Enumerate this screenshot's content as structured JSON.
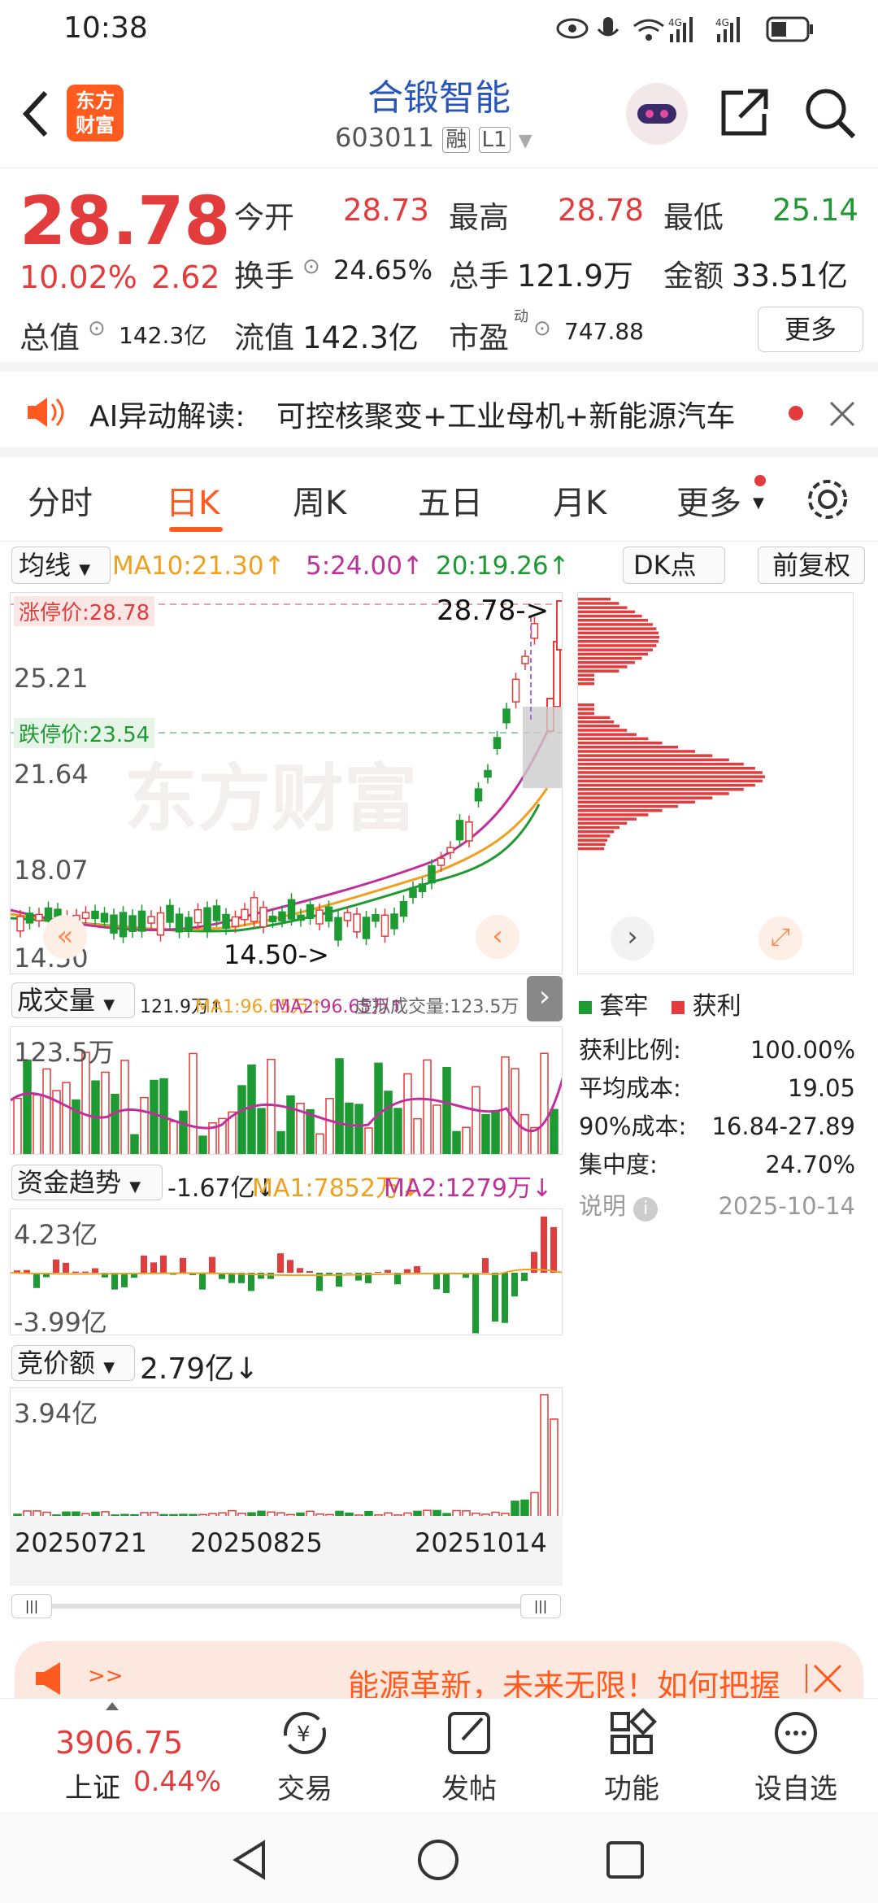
{
  "status": {
    "time": "10:38",
    "net1": "4G",
    "net2": "4G"
  },
  "header": {
    "title": "合锻智能",
    "code": "603011",
    "tag1": "融",
    "tag2": "L1",
    "logo": "东方\n财富"
  },
  "quote": {
    "price": "28.78",
    "pct": "10.02%",
    "chg": "2.62",
    "open_label": "今开",
    "open": "28.73",
    "high_label": "最高",
    "high": "28.78",
    "low_label": "最低",
    "low": "25.14",
    "turn_label": "换手",
    "turn": "24.65%",
    "vol_label": "总手",
    "vol": "121.9万",
    "amt_label": "金额",
    "amt": "33.51亿",
    "cap_label": "总值",
    "cap": "142.3亿",
    "float_label": "流值",
    "float": "142.3亿",
    "pe_label": "市盈",
    "pe_sup": "动",
    "pe": "747.88",
    "more": "更多"
  },
  "ai": {
    "label": "AI异动解读:",
    "text": "可控核聚变+工业母机+新能源汽车"
  },
  "tabs": [
    "分时",
    "日K",
    "周K",
    "五日",
    "月K",
    "更多"
  ],
  "ma_bar": {
    "sel": "均线",
    "ma10": "MA10:21.30↑",
    "ma5": "5:24.00↑",
    "ma20": "20:19.26↑",
    "dk": "DK点",
    "adj": "前复权"
  },
  "kline": {
    "limit_up": "涨停价:28.78",
    "limit_down": "跌停价:23.54",
    "y1": "25.21",
    "y2": "21.64",
    "y3": "18.07",
    "y4": "14.50",
    "high_mark": "28.78->",
    "low_mark": "14.50->",
    "watermark": "东方财富"
  },
  "volume": {
    "sel": "成交量",
    "info": "121.9万↑",
    "ma1": "MA1:96.65万↑",
    "ma2": "MA2:96.65万↑",
    "virt": "虚拟成交量:123.5万",
    "ymax": "123.5万"
  },
  "fund": {
    "sel": "资金趋势",
    "val": "-1.67亿↓",
    "ma1": "MA1:7852万↓",
    "ma2": "MA2:1279万↓",
    "ymax": "4.23亿",
    "ymin": "-3.99亿"
  },
  "bid": {
    "sel": "竞价额",
    "val": "2.79亿↓",
    "ymax": "3.94亿"
  },
  "dates": [
    "20250721",
    "20250825",
    "20251014"
  ],
  "chip": {
    "legend_trap": "套牢",
    "legend_profit": "获利",
    "profit_label": "获利比例:",
    "profit": "100.00%",
    "avg_label": "平均成本:",
    "avg": "19.05",
    "c90_label": "90%成本:",
    "c90": "16.84-27.89",
    "conc_label": "集中度:",
    "conc": "24.70%",
    "note": "说明",
    "date": "2025-10-14"
  },
  "banner": {
    "arrows": ">>",
    "text": "能源革新，未来无限！如何把握"
  },
  "nav": {
    "index": "3906.75",
    "index_name": "上证",
    "index_pct": "0.44%",
    "items": [
      "交易",
      "发帖",
      "功能",
      "设自选"
    ]
  },
  "colors": {
    "up": "#e23c3c",
    "down": "#1e9a33",
    "accent": "#ff5a1f"
  }
}
